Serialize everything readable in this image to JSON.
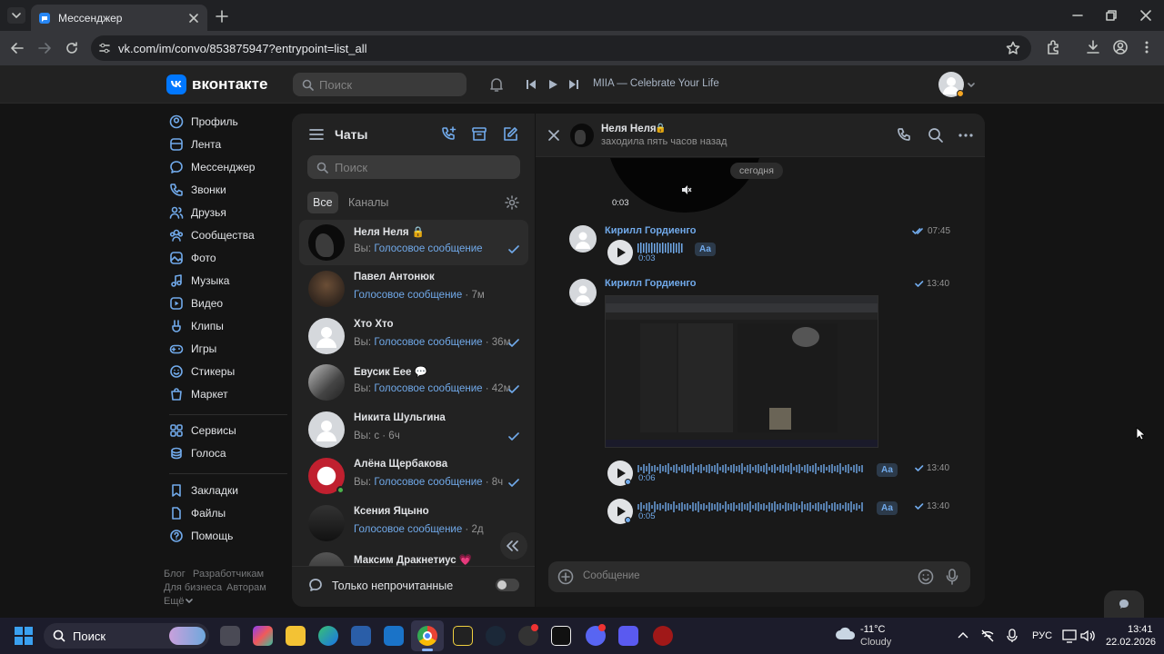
{
  "browser": {
    "tab_title": "Мессенджер",
    "url": "vk.com/im/convo/853875947?entrypoint=list_all"
  },
  "header": {
    "logo_text": "вконтакте",
    "search_placeholder": "Поиск",
    "player_track": "MIIA — Celebrate Your Life"
  },
  "menu": {
    "items": [
      "Профиль",
      "Лента",
      "Мессенджер",
      "Звонки",
      "Друзья",
      "Сообщества",
      "Фото",
      "Музыка",
      "Видео",
      "Клипы",
      "Игры",
      "Стикеры",
      "Маркет"
    ],
    "items2": [
      "Сервисы",
      "Голоса"
    ],
    "items3": [
      "Закладки",
      "Файлы",
      "Помощь"
    ],
    "footer": [
      "Блог",
      "Разработчикам",
      "Для бизнеса",
      "Авторам",
      "Ещё"
    ]
  },
  "chats": {
    "title": "Чаты",
    "search_placeholder": "Поиск",
    "tab_all": "Все",
    "tab_channels": "Каналы",
    "unread_only": "Только непрочитанные",
    "rows": [
      {
        "name": "Неля Неля 🔒",
        "prefix": "Вы: ",
        "msg": "Голосовое сообщение",
        "time": ""
      },
      {
        "name": "Павел Антонюк",
        "prefix": "",
        "msg": "Голосовое сообщение",
        "time": " · 7м"
      },
      {
        "name": "Хто Хто",
        "prefix": "Вы: ",
        "msg": "Голосовое сообщение",
        "time": " · 36м"
      },
      {
        "name": "Евусик Еее 💬",
        "prefix": "Вы: ",
        "msg": "Голосовое сообщение",
        "time": " · 42м"
      },
      {
        "name": "Никита Шульгина",
        "prefix": "Вы: с",
        "msg": "",
        "time": " · 6ч"
      },
      {
        "name": "Алёна Щербакова",
        "prefix": "Вы: ",
        "msg": "Голосовое сообщение",
        "time": " · 8ч"
      },
      {
        "name": "Ксения Яцыно",
        "prefix": "",
        "msg": "Голосовое сообщение",
        "time": " · 2д"
      },
      {
        "name": "Максим Дракнетиус 💗",
        "prefix": "",
        "msg": "",
        "time": ""
      }
    ]
  },
  "conversation": {
    "name": "Неля Неля",
    "status": "заходила пять часов назад",
    "video_time": "0:03",
    "date_pill": "сегодня",
    "message_placeholder": "Сообщение",
    "messages": [
      {
        "sender": "Кирилл Гордиенго",
        "time": "07:45",
        "duration": "0:03",
        "aa": "Аа"
      },
      {
        "sender": "Кирилл Гордиенго",
        "time": "13:40"
      },
      {
        "time": "13:40",
        "duration": "0:06",
        "aa": "Аа"
      },
      {
        "time": "13:40",
        "duration": "0:05",
        "aa": "Аа"
      }
    ]
  },
  "taskbar": {
    "search": "Поиск",
    "weather_temp": "-11°C",
    "weather_desc": "Cloudy",
    "lang": "РУС",
    "time": "13:41",
    "date": "22.02.2026"
  },
  "colors": {
    "accent": "#71aaeb",
    "bg": "#141414",
    "panel": "#222222"
  }
}
